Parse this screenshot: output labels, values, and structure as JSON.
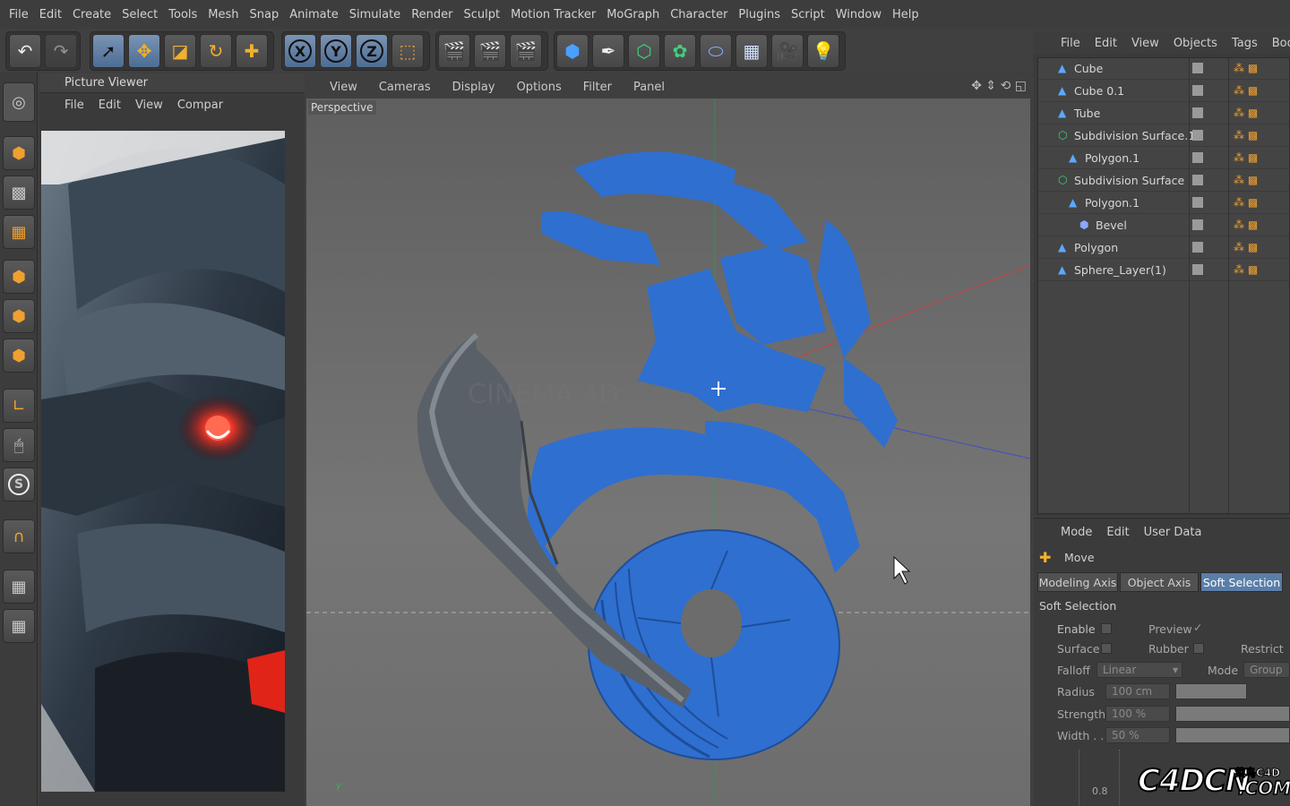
{
  "menubar": [
    "File",
    "Edit",
    "Create",
    "Select",
    "Tools",
    "Mesh",
    "Snap",
    "Animate",
    "Simulate",
    "Render",
    "Sculpt",
    "Motion Tracker",
    "MoGraph",
    "Character",
    "Plugins",
    "Script",
    "Window",
    "Help"
  ],
  "toolbar": {
    "axis_x": "X",
    "axis_y": "Y",
    "axis_z": "Z"
  },
  "picture_viewer": {
    "title": "Picture Viewer",
    "menu": [
      "File",
      "Edit",
      "View",
      "Compar"
    ]
  },
  "viewport": {
    "menu": [
      "View",
      "Cameras",
      "Display",
      "Options",
      "Filter",
      "Panel"
    ],
    "camera_label": "Perspective",
    "watermark": "CINEMA 4D",
    "axis_y_label": "y"
  },
  "object_manager": {
    "menu": [
      "File",
      "Edit",
      "View",
      "Objects",
      "Tags",
      "Book"
    ],
    "objects": [
      {
        "name": "Cube",
        "indent": 0
      },
      {
        "name": "Cube 0.1",
        "indent": 0
      },
      {
        "name": "Tube",
        "indent": 0
      },
      {
        "name": "Subdivision Surface.1",
        "indent": 0
      },
      {
        "name": "Polygon.1",
        "indent": 1
      },
      {
        "name": "Subdivision Surface",
        "indent": 0
      },
      {
        "name": "Polygon.1",
        "indent": 1
      },
      {
        "name": "Bevel",
        "indent": 2
      },
      {
        "name": "Polygon",
        "indent": 0
      },
      {
        "name": "Sphere_Layer(1)",
        "indent": 0
      }
    ]
  },
  "attribute_manager": {
    "menu": [
      "Mode",
      "Edit",
      "User Data"
    ],
    "tool_name": "Move",
    "tabs": [
      "Modeling Axis",
      "Object Axis",
      "Soft Selection"
    ],
    "active_tab": "Soft Selection",
    "section": "Soft Selection",
    "enable_label": "Enable",
    "preview_label": "Preview",
    "surface_label": "Surface",
    "rubber_label": "Rubber",
    "restrict_label": "Restrict",
    "falloff_label": "Falloff",
    "falloff_value": "Linear",
    "mode_label": "Mode",
    "mode_value": "Group",
    "radius_label": "Radius",
    "radius_value": "100 cm",
    "strength_label": "Strength",
    "strength_value": "100 %",
    "width_label": "Width . .",
    "width_value": "50 %",
    "graph_tick": "0.8"
  },
  "watermark": {
    "logo_text": "C4DCN",
    "logo_sub": "菜鸟C4D",
    "logo_dom": ".COM"
  },
  "colors": {
    "accent_blue": "#2f6fd0",
    "selection_tab": "#5a7ea8"
  }
}
